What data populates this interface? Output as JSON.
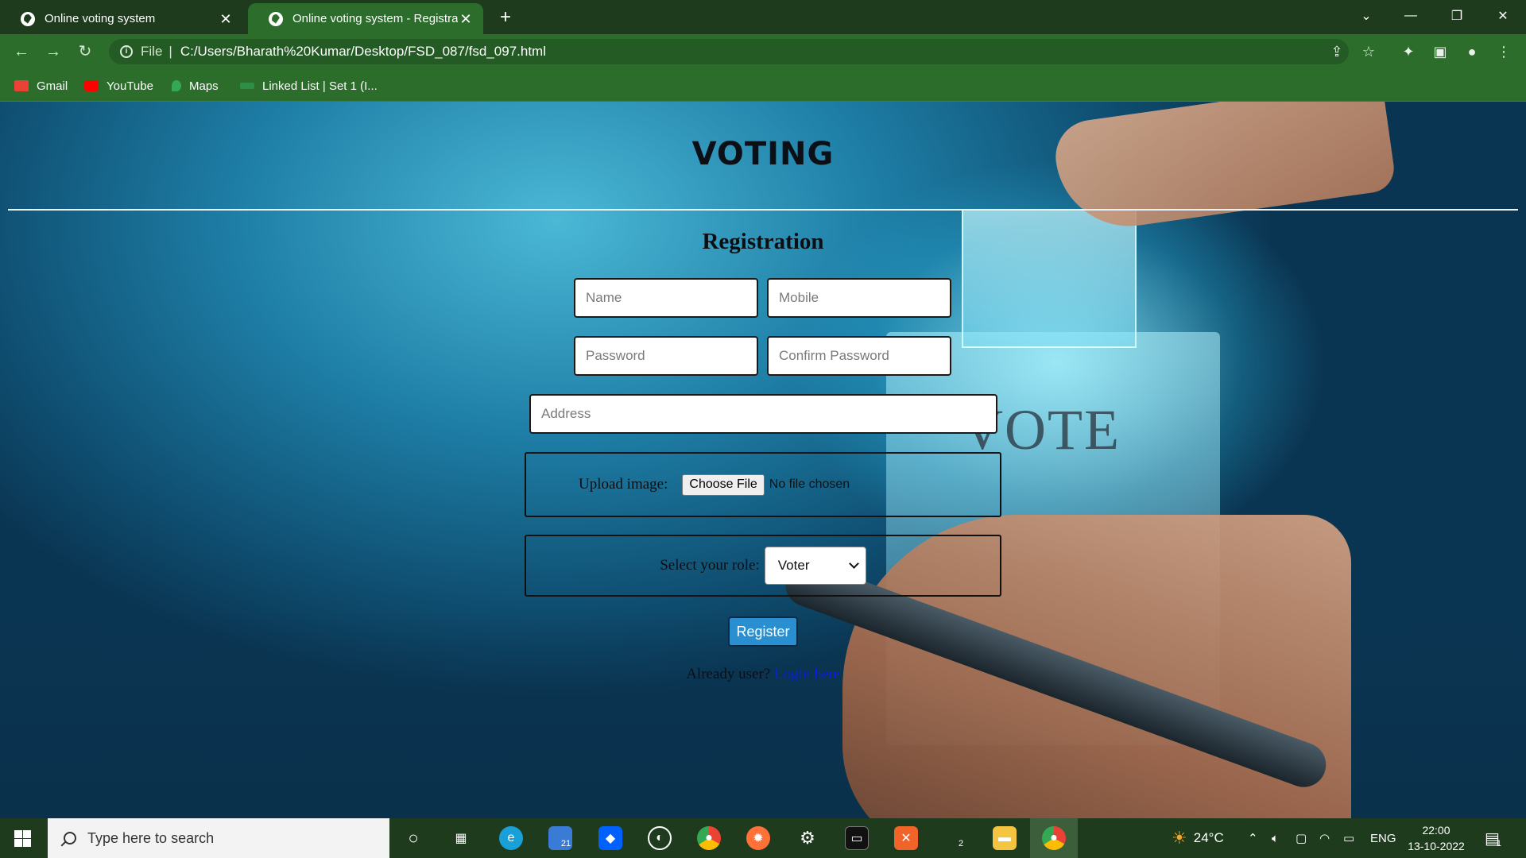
{
  "browser": {
    "tabs": [
      {
        "title": "Online voting system",
        "close": "✕"
      },
      {
        "title": "Online voting system - Registration",
        "close": "✕"
      }
    ],
    "new_tab": "+",
    "window_controls": {
      "minimize": "—",
      "maximize": "❐",
      "close": "✕",
      "tab_search": "⌄"
    },
    "nav": {
      "back": "←",
      "forward": "→",
      "reload": "↻"
    },
    "address": {
      "info": "i",
      "scheme": "File",
      "separator": "|",
      "url": "C:/Users/Bharath%20Kumar/Desktop/FSD_087/fsd_097.html"
    },
    "bookmarks": [
      {
        "label": "Gmail",
        "color": "#ea4335"
      },
      {
        "label": "YouTube",
        "color": "#ff0000"
      },
      {
        "label": "Maps",
        "color": "#34a853"
      },
      {
        "label": "Linked List | Set 1 (I...",
        "color": "#2f8d46"
      }
    ]
  },
  "page": {
    "site_title": "VOTING",
    "heading": "Registration",
    "fields": {
      "name": {
        "placeholder": "Name",
        "value": ""
      },
      "mobile": {
        "placeholder": "Mobile",
        "value": ""
      },
      "password": {
        "placeholder": "Password",
        "value": ""
      },
      "confirm_password": {
        "placeholder": "Confirm Password",
        "value": ""
      },
      "address": {
        "placeholder": "Address",
        "value": ""
      }
    },
    "upload": {
      "label": "Upload image:",
      "button": "Choose File",
      "status": "No file chosen"
    },
    "role": {
      "label": "Select your role:",
      "selected": "Voter"
    },
    "register_button": "Register",
    "login_prompt": {
      "text": "Already user?",
      "link": "Login here"
    },
    "background_text": "VOTE"
  },
  "taskbar": {
    "search_placeholder": "Type here to search",
    "mail_badge": "21",
    "pen_badge": "2",
    "weather": "24°C",
    "language": "ENG",
    "time": "22:00",
    "date": "13-10-2022",
    "notification_count": "1"
  },
  "colors": {
    "chrome_dark": "#1f3b1e",
    "chrome": "#2c6d2c",
    "register_button": "#2a8fd0",
    "link": "#0a1fe0"
  }
}
